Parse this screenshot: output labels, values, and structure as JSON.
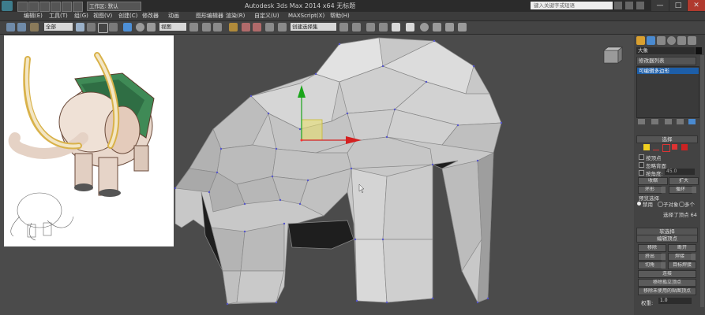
{
  "titlebar": {
    "workspace": "工作区: 默认",
    "title": "Autodesk 3ds Max  2014 x64    无标题",
    "search_placeholder": "键入关键字或短语",
    "minimize": "—",
    "maximize": "□",
    "close": "✕"
  },
  "menu": [
    "编辑(E)",
    "工具(T)",
    "组(G)",
    "视图(V)",
    "创建(C)",
    "修改器",
    "动画",
    "图形编辑器",
    "渲染(R)",
    "自定义(U)",
    "MAXScript(X)",
    "帮助(H)"
  ],
  "toolbar": {
    "filter": "全部",
    "coord": "视图",
    "selection_set": "创建选择集"
  },
  "command_panel": {
    "object_name": "大象",
    "modifier_list": "修改器列表",
    "stack_item": "可编辑多边形",
    "selection_rollout": "选择",
    "by_vertex": "按顶点",
    "ignore_backfacing": "忽略背面",
    "by_angle": "按角度:",
    "angle_value": "45.0",
    "shrink": "收缩",
    "grow": "扩大",
    "ring": "环形",
    "loop": "循环",
    "preview_selection": "预览选择",
    "disabled": "禁用",
    "subobject": "子对象",
    "multiple": "多个",
    "selected_count": "选择了顶点 64",
    "soft_selection": "软选择",
    "edit_vertices": "编辑顶点",
    "remove": "移除",
    "break": "断开",
    "extrude": "挤出",
    "weld": "焊接",
    "chamfer": "切角",
    "target_weld": "目标焊接",
    "connect": "连接",
    "remove_isolated": "移除孤立顶点",
    "remove_unused_map": "移除未使用的贴图顶点",
    "weight_label": "权重:",
    "weight_value": "1.0"
  },
  "colors": {
    "x_axis": "#d42020",
    "y_axis": "#1aa51a",
    "stack_highlight": "#1d5ea8"
  }
}
